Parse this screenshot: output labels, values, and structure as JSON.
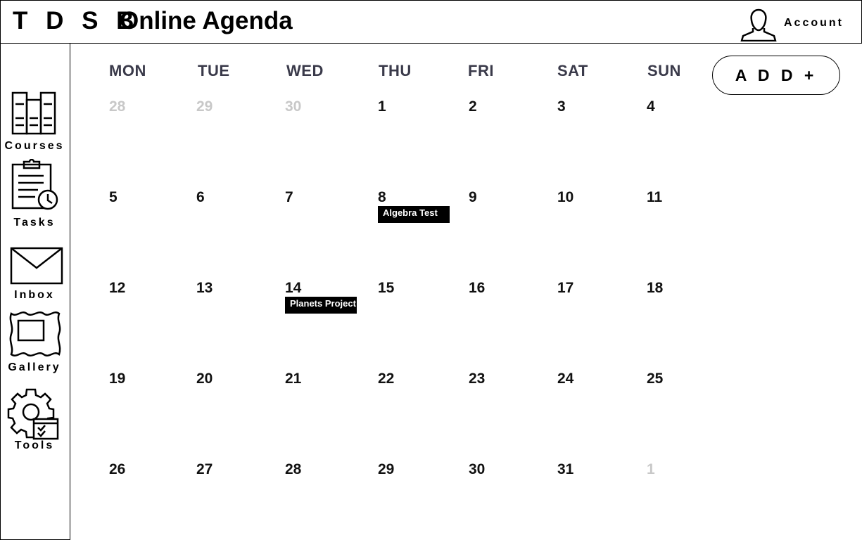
{
  "header": {
    "brand": "T D S B",
    "title": "Online Agenda",
    "account_label": "Account"
  },
  "sidebar": {
    "items": [
      {
        "label": "Courses",
        "icon": "books-icon"
      },
      {
        "label": "Tasks",
        "icon": "clipboard-clock-icon"
      },
      {
        "label": "Inbox",
        "icon": "envelope-icon"
      },
      {
        "label": "Gallery",
        "icon": "picture-frame-icon"
      },
      {
        "label": "Tools",
        "icon": "gear-checklist-icon"
      }
    ]
  },
  "calendar": {
    "weekdays": [
      "MON",
      "TUE",
      "WED",
      "THU",
      "FRI",
      "SAT",
      "SUN"
    ],
    "weeks": [
      [
        {
          "d": "28",
          "muted": true
        },
        {
          "d": "29",
          "muted": true
        },
        {
          "d": "30",
          "muted": true
        },
        {
          "d": "1"
        },
        {
          "d": "2"
        },
        {
          "d": "3"
        },
        {
          "d": "4"
        }
      ],
      [
        {
          "d": "5"
        },
        {
          "d": "6"
        },
        {
          "d": "7"
        },
        {
          "d": "8",
          "event": "Algebra Test"
        },
        {
          "d": "9"
        },
        {
          "d": "10"
        },
        {
          "d": "11"
        }
      ],
      [
        {
          "d": "12"
        },
        {
          "d": "13"
        },
        {
          "d": "14",
          "event": "Planets Project"
        },
        {
          "d": "15"
        },
        {
          "d": "16"
        },
        {
          "d": "17"
        },
        {
          "d": "18"
        }
      ],
      [
        {
          "d": "19"
        },
        {
          "d": "20"
        },
        {
          "d": "21"
        },
        {
          "d": "22"
        },
        {
          "d": "23"
        },
        {
          "d": "24"
        },
        {
          "d": "25"
        }
      ],
      [
        {
          "d": "26"
        },
        {
          "d": "27"
        },
        {
          "d": "28"
        },
        {
          "d": "29"
        },
        {
          "d": "30"
        },
        {
          "d": "31"
        },
        {
          "d": "1",
          "muted": true
        }
      ]
    ]
  },
  "add_button_label": "A D D +"
}
